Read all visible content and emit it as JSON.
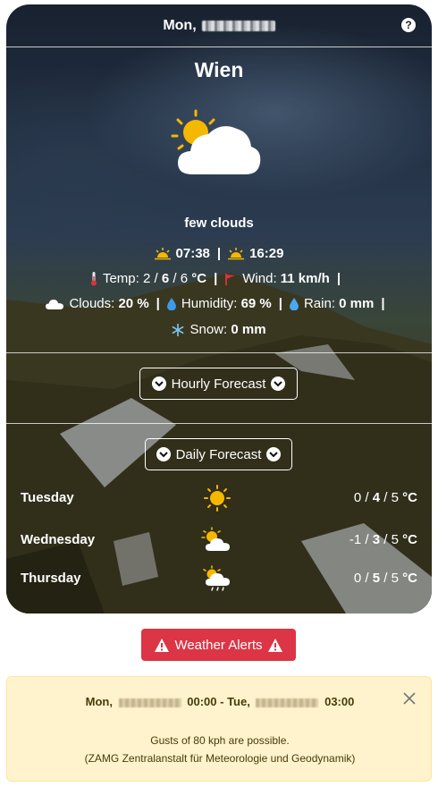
{
  "header": {
    "date_label": "Mon,"
  },
  "location": {
    "city": "Wien"
  },
  "current": {
    "icon": "sun-cloud-icon",
    "description": "few clouds",
    "sunrise": "07:38",
    "sunset": "16:29",
    "temp_label": "Temp:",
    "temp_min": "2",
    "temp_cur": "6",
    "temp_max": "6",
    "temp_unit": "°C",
    "wind_label": "Wind:",
    "wind_value": "11 km/h",
    "clouds_label": "Clouds:",
    "clouds_value": "20 %",
    "humidity_label": "Humidity:",
    "humidity_value": "69 %",
    "rain_label": "Rain:",
    "rain_value": "0 mm",
    "snow_label": "Snow:",
    "snow_value": "0 mm"
  },
  "hourly_button": "Hourly Forecast",
  "daily_button": "Daily Forecast",
  "daily": [
    {
      "day": "Tuesday",
      "icon": "sun-icon",
      "min": "0",
      "cur": "4",
      "max": "5",
      "unit": "°C"
    },
    {
      "day": "Wednesday",
      "icon": "sun-cloud-icon",
      "min": "-1",
      "cur": "3",
      "max": "5",
      "unit": "°C"
    },
    {
      "day": "Thursday",
      "icon": "sun-cloud-rain-icon",
      "min": "0",
      "cur": "5",
      "max": "5",
      "unit": "°C"
    }
  ],
  "alerts": {
    "button_label": "Weather Alerts",
    "start_prefix": "Mon,",
    "start_time": "00:00",
    "separator": "-",
    "end_prefix": "Tue,",
    "end_time": "03:00",
    "text": "Gusts of 80 kph are possible.",
    "source": "(ZAMG Zentralanstalt für Meteorologie und Geodynamik)"
  },
  "colors": {
    "alert_red": "#dc3545",
    "alert_bg": "#fff3cd",
    "sun": "#f5b800"
  }
}
